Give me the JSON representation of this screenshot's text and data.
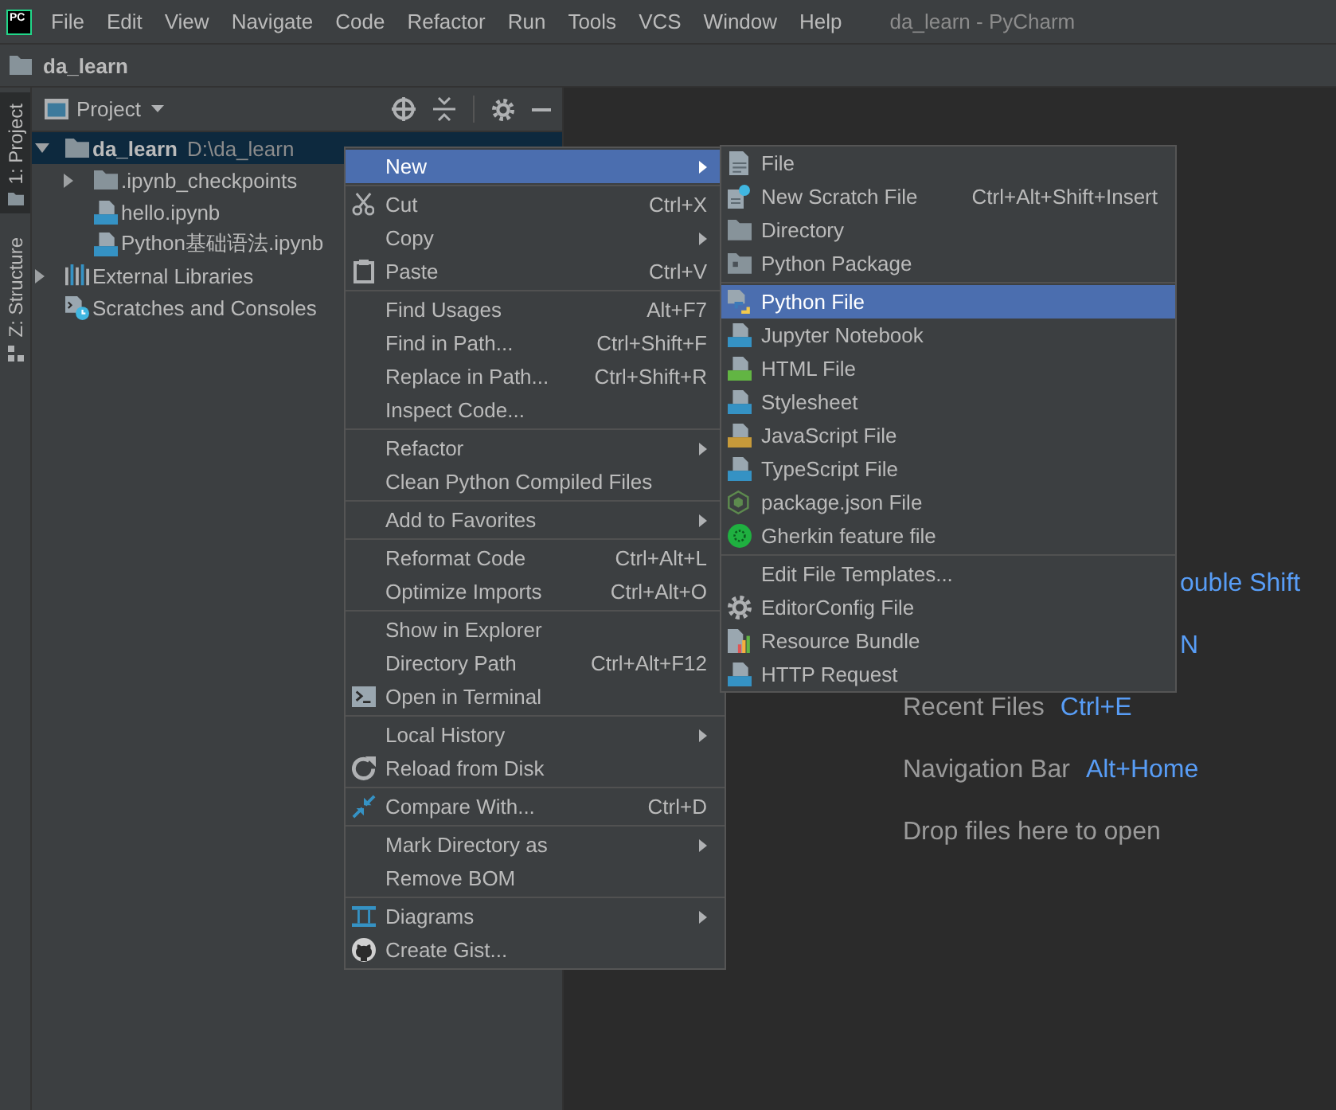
{
  "window": {
    "title": "da_learn - PyCharm"
  },
  "menu_bar": {
    "logo": "PC",
    "items": [
      "File",
      "Edit",
      "View",
      "Navigate",
      "Code",
      "Refactor",
      "Run",
      "Tools",
      "VCS",
      "Window",
      "Help"
    ]
  },
  "navigation_bar": {
    "path": "da_learn"
  },
  "tool_strip": {
    "tabs": [
      {
        "label": "1: Project",
        "selected": true
      },
      {
        "label": "Z: Structure",
        "selected": false
      }
    ]
  },
  "project_panel": {
    "title": "Project",
    "tree": [
      {
        "label": "da_learn",
        "path": "D:\\da_learn",
        "kind": "folder",
        "expanded": true,
        "selected": true,
        "children": [
          {
            "label": ".ipynb_checkpoints",
            "kind": "folder",
            "expanded": false,
            "selected": false
          },
          {
            "label": "hello.ipynb",
            "kind": "notebook",
            "selected": false
          },
          {
            "label": "Python基础语法.ipynb",
            "kind": "notebook",
            "selected": false
          }
        ]
      },
      {
        "label": "External Libraries",
        "kind": "libraries",
        "expanded": false,
        "selected": false
      },
      {
        "label": "Scratches and Consoles",
        "kind": "scratches",
        "selected": false
      }
    ]
  },
  "context_menu": {
    "groups": [
      [
        {
          "label": "New",
          "submenu": true,
          "selected": true
        }
      ],
      [
        {
          "label": "Cut",
          "shortcut": "Ctrl+X",
          "submenu": false,
          "selected": false
        },
        {
          "label": "Copy",
          "submenu": true,
          "selected": false
        },
        {
          "label": "Paste",
          "shortcut": "Ctrl+V",
          "submenu": false,
          "selected": false
        }
      ],
      [
        {
          "label": "Find Usages",
          "shortcut": "Alt+F7",
          "submenu": false,
          "selected": false
        },
        {
          "label": "Find in Path...",
          "shortcut": "Ctrl+Shift+F",
          "submenu": false,
          "selected": false
        },
        {
          "label": "Replace in Path...",
          "shortcut": "Ctrl+Shift+R",
          "submenu": false,
          "selected": false
        },
        {
          "label": "Inspect Code...",
          "submenu": false,
          "selected": false
        }
      ],
      [
        {
          "label": "Refactor",
          "submenu": true,
          "selected": false
        },
        {
          "label": "Clean Python Compiled Files",
          "submenu": false,
          "selected": false
        }
      ],
      [
        {
          "label": "Add to Favorites",
          "submenu": true,
          "selected": false
        }
      ],
      [
        {
          "label": "Reformat Code",
          "shortcut": "Ctrl+Alt+L",
          "submenu": false,
          "selected": false
        },
        {
          "label": "Optimize Imports",
          "shortcut": "Ctrl+Alt+O",
          "submenu": false,
          "selected": false
        }
      ],
      [
        {
          "label": "Show in Explorer",
          "submenu": false,
          "selected": false
        },
        {
          "label": "Directory Path",
          "shortcut": "Ctrl+Alt+F12",
          "submenu": false,
          "selected": false
        },
        {
          "label": "Open in Terminal",
          "submenu": false,
          "selected": false
        }
      ],
      [
        {
          "label": "Local History",
          "submenu": true,
          "selected": false
        },
        {
          "label": "Reload from Disk",
          "submenu": false,
          "selected": false
        }
      ],
      [
        {
          "label": "Compare With...",
          "shortcut": "Ctrl+D",
          "submenu": false,
          "selected": false
        }
      ],
      [
        {
          "label": "Mark Directory as",
          "submenu": true,
          "selected": false
        },
        {
          "label": "Remove BOM",
          "submenu": false,
          "selected": false
        }
      ],
      [
        {
          "label": "Diagrams",
          "submenu": true,
          "selected": false
        },
        {
          "label": "Create Gist...",
          "submenu": false,
          "selected": false
        }
      ]
    ]
  },
  "new_submenu": {
    "groups": [
      [
        {
          "label": "File",
          "selected": false
        },
        {
          "label": "New Scratch File",
          "shortcut": "Ctrl+Alt+Shift+Insert",
          "selected": false
        },
        {
          "label": "Directory",
          "selected": false
        },
        {
          "label": "Python Package",
          "selected": false
        }
      ],
      [
        {
          "label": "Python File",
          "selected": true
        },
        {
          "label": "Jupyter Notebook",
          "selected": false
        },
        {
          "label": "HTML File",
          "selected": false
        },
        {
          "label": "Stylesheet",
          "selected": false
        },
        {
          "label": "JavaScript File",
          "selected": false
        },
        {
          "label": "TypeScript File",
          "selected": false
        },
        {
          "label": "package.json File",
          "selected": false
        },
        {
          "label": "Gherkin feature file",
          "selected": false
        }
      ],
      [
        {
          "label": "Edit File Templates...",
          "selected": false
        },
        {
          "label": "EditorConfig File",
          "selected": false
        },
        {
          "label": "Resource Bundle",
          "selected": false
        },
        {
          "label": "HTTP Request",
          "selected": false
        }
      ]
    ]
  },
  "welcome_hints": [
    {
      "shortcut": "ouble Shift"
    },
    {
      "shortcut": "N"
    },
    {
      "label": "Recent Files",
      "shortcut": "Ctrl+E"
    },
    {
      "label": "Navigation Bar",
      "shortcut": "Alt+Home"
    },
    {
      "label": "Drop files here to open"
    }
  ]
}
